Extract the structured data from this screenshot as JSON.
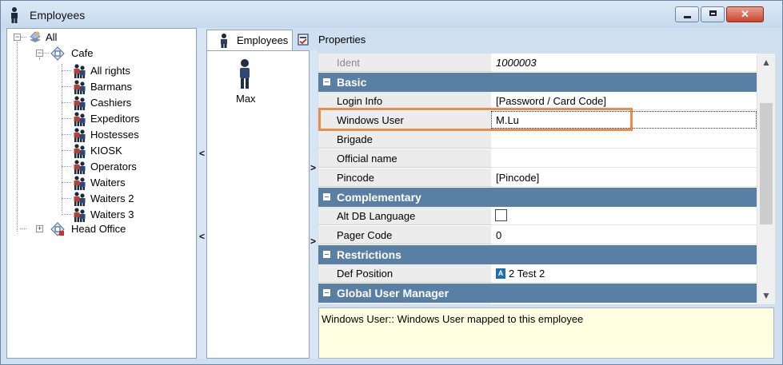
{
  "window": {
    "title": "Employees",
    "controls": {
      "minimize": "minimize",
      "maximize": "maximize",
      "close": "✕"
    }
  },
  "tree": {
    "root": "All",
    "cafe": "Cafe",
    "groups": [
      "All rights",
      "Barmans",
      "Cashiers",
      "Expeditors",
      "Hostesses",
      "KIOSK",
      "Operators",
      "Waiters",
      "Waiters 2",
      "Waiters 3"
    ],
    "head_office": "Head Office"
  },
  "splitters": {
    "left_arrow": "<",
    "right_arrow": ">"
  },
  "tabs": {
    "employees": "Employees",
    "properties": "Properties"
  },
  "employee_list": {
    "items": [
      "Max"
    ]
  },
  "properties": {
    "ident": {
      "name": "Ident",
      "value": "1000003"
    },
    "sections": {
      "basic": "Basic",
      "complementary": "Complementary",
      "restrictions": "Restrictions",
      "global_user_manager": "Global User Manager"
    },
    "rows": {
      "login_info": {
        "name": "Login Info",
        "value": "[Password / Card Code]"
      },
      "windows_user": {
        "name": "Windows User",
        "value": "M.Lu"
      },
      "brigade": {
        "name": "Brigade",
        "value": ""
      },
      "official_name": {
        "name": "Official name",
        "value": ""
      },
      "pincode": {
        "name": "Pincode",
        "value": "[Pincode]"
      },
      "alt_db_language": {
        "name": "Alt DB Language",
        "checked": false
      },
      "pager_code": {
        "name": "Pager Code",
        "value": "0"
      },
      "def_position": {
        "name": "Def Position",
        "value": "2 Test 2",
        "icon": "A"
      }
    }
  },
  "description": "Windows User:: Windows User mapped to this employee",
  "colors": {
    "section_header": "#5a7fa5",
    "highlight": "#f08a4b",
    "description_bg": "#ffffe1"
  }
}
